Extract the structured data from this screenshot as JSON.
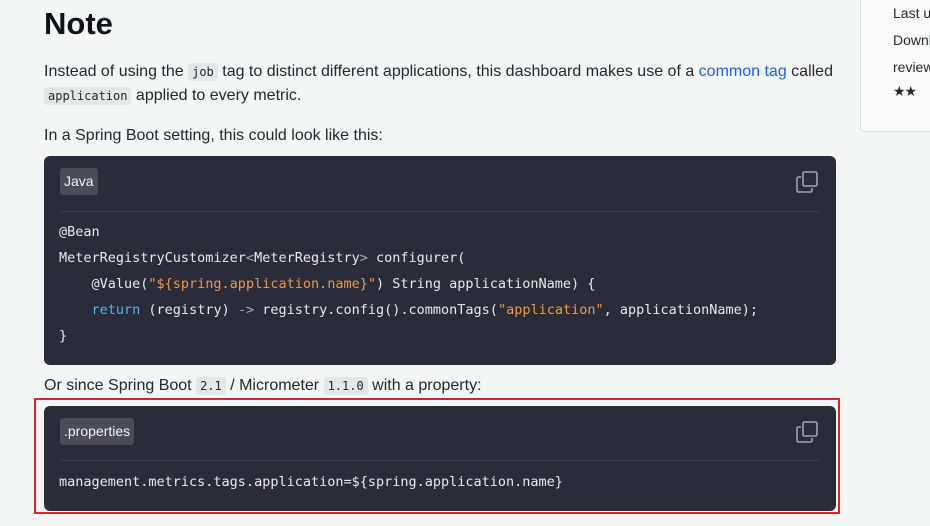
{
  "heading": "Note",
  "para1": {
    "t1": "Instead of using the ",
    "code1": "job",
    "t2": " tag to distinct different applications, this dashboard makes use of a ",
    "link": "common tag",
    "t3": " called ",
    "code2": "application",
    "t4": " applied to every metric."
  },
  "para2": "In a Spring Boot setting, this could look like this:",
  "java_block": {
    "lang": "Java",
    "lines": {
      "l1": "@Bean",
      "l2a": "MeterRegistryCustomizer",
      "l2b": "<",
      "l2c": "MeterRegistry",
      "l2d": ">",
      "l2e": " configurer(",
      "l3a": "    @Value(",
      "l3b": "\"${spring.application.name}\"",
      "l3c": ") String applicationName) {",
      "l4a": "    ",
      "l4b": "return",
      "l4c": " (registry) ",
      "l4d": "->",
      "l4e": " registry.config().commonTags(",
      "l4f": "\"application\"",
      "l4g": ", applicationName);",
      "l5": "}"
    }
  },
  "para3": {
    "t1": "Or since Spring Boot ",
    "code1": "2.1",
    "t2": " / Micrometer ",
    "code2": "1.1.0",
    "t3": " with a property:"
  },
  "props_block": {
    "lang": ".properties",
    "line": "management.metrics.tags.application=${spring.application.name}"
  },
  "sidebar": {
    "line1": "Last u",
    "line2": "Downl",
    "line3": "review",
    "stars": "★★"
  },
  "colors": {
    "highlight": "#e0202c",
    "link": "#1f62e0",
    "code_bg": "#2b2c3a"
  }
}
